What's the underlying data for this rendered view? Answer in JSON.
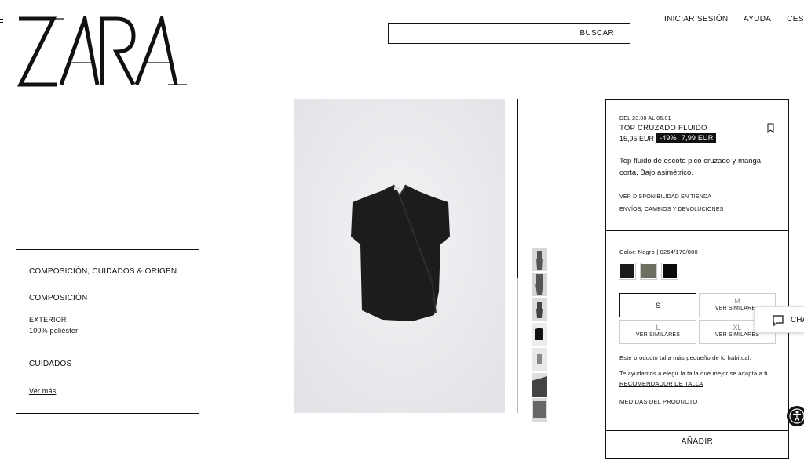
{
  "header": {
    "logo_text": "ZARA",
    "search_label": "BUSCAR",
    "nav": [
      "INICIAR SESIÓN",
      "AYUDA",
      "CESTA"
    ]
  },
  "composition_box": {
    "title": "COMPOSICIÓN, CUIDADOS & ORIGEN",
    "composition_heading": "COMPOSICIÓN",
    "exterior_label": "EXTERIOR",
    "exterior_value": "100% poliéster",
    "care_heading": "CUIDADOS",
    "more_link": "Ver más"
  },
  "product": {
    "dates": "DEL 23.08 AL 06.01",
    "name": "TOP CRUZADO FLUIDO",
    "old_price": "15,95 EUR",
    "discount": "-49%",
    "new_price": "7,99 EUR",
    "description": "Top fluido de escote pico cruzado y manga corta. Bajo asimétrico.",
    "store_availability": "VER DISPONIBILIDAD EN TIENDA",
    "shipping": "ENVÍOS, CAMBIOS Y DEVOLUCIONES",
    "color_line": "Color: Negro | 0264/170/800",
    "swatch_colors": [
      "#1a1a1a",
      "#6b7060",
      "#0a0a0a"
    ],
    "sizes": [
      {
        "size": "S",
        "note": ""
      },
      {
        "size": "M",
        "note": "VER SIMILARES"
      },
      {
        "size": "L",
        "note": "VER SIMILARES"
      },
      {
        "size": "XL",
        "note": "VER SIMILARES"
      }
    ],
    "fit_note": "Este producto talla más pequeño de lo habitual.",
    "help_text": "Te ayudamos a elegir la talla que mejor se adapta a ti.",
    "size_recommender": "RECOMENDADOR DE TALLA",
    "measurements": "MEDIDAS DEL PRODUCTO",
    "add_button": "AÑADIR"
  },
  "chat": {
    "label": "CHA"
  }
}
